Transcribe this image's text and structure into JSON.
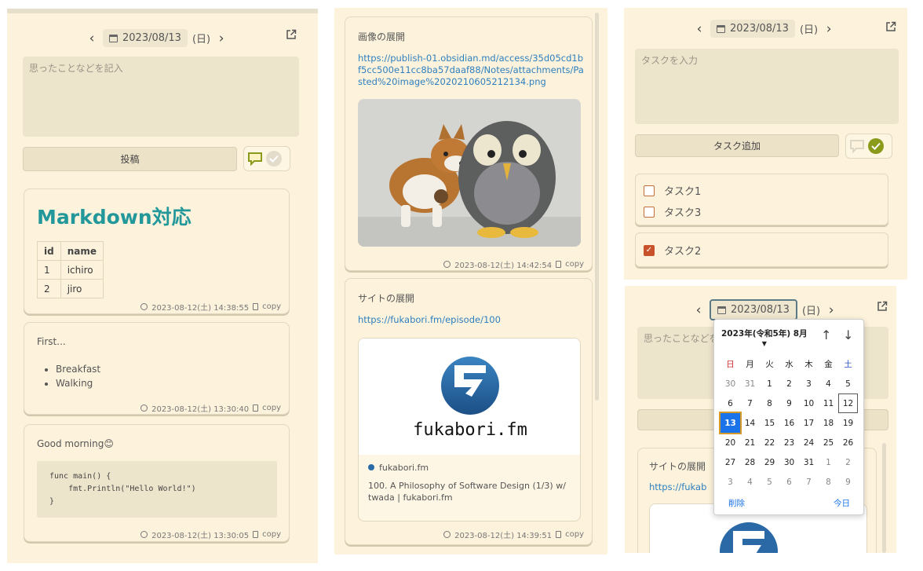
{
  "colors": {
    "bg": "#fdf3dc",
    "accent_teal": "#23989a",
    "link": "#2e7fbf",
    "check": "#8a9a1b",
    "task_check": "#c8532a",
    "selected_day": "#1a73e8"
  },
  "panel1": {
    "date": "2023/08/13",
    "weekday": "(日)",
    "placeholder": "思ったことなどを記入",
    "post_button": "投稿",
    "cards": [
      {
        "heading": "Markdown対応",
        "table": {
          "headers": [
            "id",
            "name"
          ],
          "rows": [
            [
              "1",
              "ichiro"
            ],
            [
              "2",
              "jiro"
            ]
          ]
        },
        "timestamp": "2023-08-12(土) 14:38:55",
        "copy": "copy"
      },
      {
        "text": "First...",
        "bullets": [
          "Breakfast",
          "Walking"
        ],
        "timestamp": "2023-08-12(土) 13:30:40",
        "copy": "copy"
      },
      {
        "text": "Good morning",
        "emoji": "😊",
        "code": "func main() {\n    fmt.Println(\"Hello World!\")\n}",
        "timestamp": "2023-08-12(土) 13:30:05",
        "copy": "copy"
      }
    ]
  },
  "panel2": {
    "cards": [
      {
        "title": "画像の展開",
        "url": "https://publish-01.obsidian.md/access/35d05cd1bf5cc500e11cc8ba57daaf88/Notes/attachments/Pasted%20image%2020210605212134.png",
        "timestamp": "2023-08-12(土) 14:42:54",
        "copy": "copy"
      },
      {
        "title": "サイトの展開",
        "url": "https://fukabori.fm/episode/100",
        "link_card": {
          "logo_text": "fukabori.fm",
          "site": "fukabori.fm",
          "description": "100. A Philosophy of Software Design (1/3) w/ twada | fukabori.fm"
        },
        "timestamp": "2023-08-12(土) 14:39:51",
        "copy": "copy"
      }
    ]
  },
  "panel3": {
    "date": "2023/08/13",
    "weekday": "(日)",
    "placeholder": "タスクを入力",
    "add_button": "タスク追加",
    "open_tasks": [
      "タスク1",
      "タスク3"
    ],
    "done_tasks": [
      "タスク2"
    ]
  },
  "panel4": {
    "date": "2023/08/13",
    "weekday": "(日)",
    "placeholder": "思ったことなどを",
    "card_title": "サイトの展開",
    "card_url": "https://fukab",
    "datepicker": {
      "month_label": "2023年(令和5年) 8月",
      "weekdays": [
        "日",
        "月",
        "火",
        "水",
        "木",
        "金",
        "土"
      ],
      "days": [
        [
          "30",
          "31",
          "1",
          "2",
          "3",
          "4",
          "5"
        ],
        [
          "6",
          "7",
          "8",
          "9",
          "10",
          "11",
          "12"
        ],
        [
          "13",
          "14",
          "15",
          "16",
          "17",
          "18",
          "19"
        ],
        [
          "20",
          "21",
          "22",
          "23",
          "24",
          "25",
          "26"
        ],
        [
          "27",
          "28",
          "29",
          "30",
          "31",
          "1",
          "2"
        ],
        [
          "3",
          "4",
          "5",
          "6",
          "7",
          "8",
          "9"
        ]
      ],
      "selected": "13",
      "today": "12",
      "clear": "削除",
      "today_label": "今日"
    }
  }
}
